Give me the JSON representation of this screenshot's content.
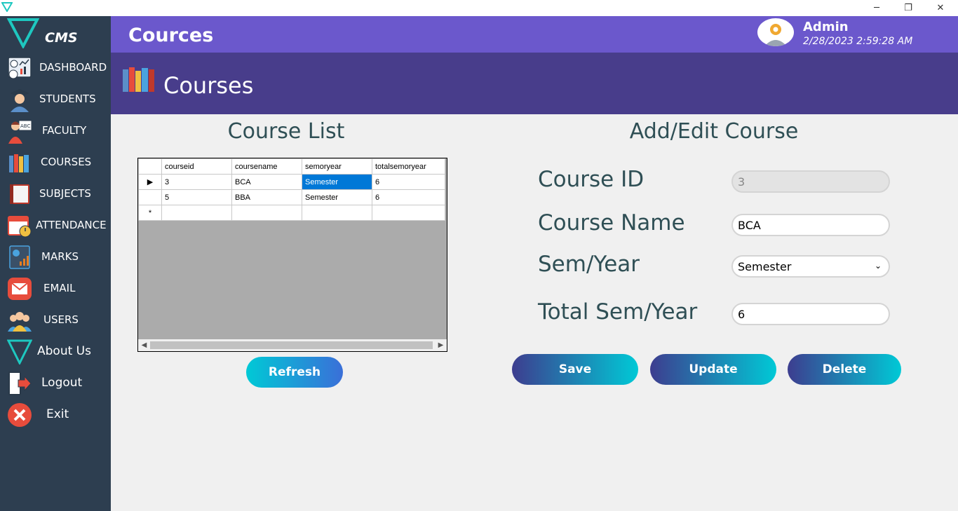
{
  "window": {
    "minimize": "─",
    "restore": "❐",
    "close": "✕"
  },
  "app": {
    "name": "CMS"
  },
  "sidebar": {
    "items": [
      {
        "label": "DASHBOARD",
        "icon": "dashboard-icon"
      },
      {
        "label": "STUDENTS",
        "icon": "student-icon"
      },
      {
        "label": "FACULTY",
        "icon": "faculty-icon"
      },
      {
        "label": "COURSES",
        "icon": "books-icon"
      },
      {
        "label": "SUBJECTS",
        "icon": "book-icon"
      },
      {
        "label": "ATTENDANCE",
        "icon": "calendar-icon"
      },
      {
        "label": "MARKS",
        "icon": "report-icon"
      },
      {
        "label": "EMAIL",
        "icon": "email-icon"
      },
      {
        "label": "USERS",
        "icon": "users-icon"
      },
      {
        "label": "About Us",
        "icon": "logo-triangle-icon"
      },
      {
        "label": "Logout",
        "icon": "logout-icon"
      },
      {
        "label": "Exit",
        "icon": "exit-icon"
      }
    ]
  },
  "header": {
    "title": "Cources",
    "user_name": "Admin",
    "datetime": "2/28/2023 2:59:28 AM"
  },
  "banner": {
    "title": "Courses"
  },
  "list": {
    "heading": "Course List",
    "columns": [
      "courseid",
      "coursename",
      "semoryear",
      "totalsemoryear"
    ],
    "rows": [
      [
        "3",
        "BCA",
        "Semester",
        "6"
      ],
      [
        "5",
        "BBA",
        "Semester",
        "6"
      ]
    ],
    "new_row_marker": "*",
    "refresh_label": "Refresh"
  },
  "form": {
    "heading": "Add/Edit Course",
    "course_id_label": "Course ID",
    "course_id_value": "3",
    "course_name_label": "Course Name",
    "course_name_value": "BCA",
    "sem_year_label": "Sem/Year",
    "sem_year_value": "Semester",
    "total_label": "Total Sem/Year",
    "total_value": "6",
    "save_label": "Save",
    "update_label": "Update",
    "delete_label": "Delete"
  },
  "colors": {
    "sidebar": "#2d3e50",
    "header": "#6b58cc",
    "banner": "#483d8b",
    "accent_cyan": "#00c9d6",
    "heading_text": "#2f4f55"
  }
}
